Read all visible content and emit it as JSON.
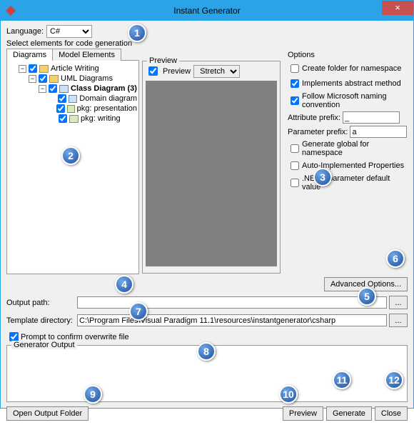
{
  "window": {
    "title": "Instant Generator"
  },
  "language": {
    "label": "Language:",
    "value": "C#"
  },
  "select_elements_label": "Select elements for code generation",
  "tabs": {
    "diagrams": "Diagrams",
    "model_elements": "Model Elements"
  },
  "tree": {
    "root": "Article Writing",
    "uml": "UML Diagrams",
    "class_diagram": "Class Diagram (3)",
    "items": [
      "Domain diagram",
      "pkg: presentation",
      "pkg: writing"
    ]
  },
  "preview": {
    "legend": "Preview",
    "checkbox_label": "Preview",
    "stretch": "Stretch"
  },
  "options": {
    "legend": "Options",
    "create_folder": "Create folder for namespace",
    "implements_abstract": "Implements abstract method",
    "follow_naming": "Follow Microsoft naming convention",
    "attr_prefix_label": "Attribute prefix:",
    "attr_prefix_value": "_",
    "param_prefix_label": "Parameter prefix:",
    "param_prefix_value": "a",
    "gen_global": "Generate global for namespace",
    "auto_impl": "Auto-Implemented Properties",
    "net4": ".NET 4 parameter default value",
    "advanced": "Advanced Options..."
  },
  "output_path": {
    "label": "Output path:",
    "value": ""
  },
  "template_dir": {
    "label": "Template directory:",
    "value": "C:\\Program Files\\Visual Paradigm 11.1\\resources\\instantgenerator\\csharp"
  },
  "prompt_overwrite": "Prompt to confirm overwrite file",
  "generator_output": "Generator Output",
  "buttons": {
    "open_output": "Open Output Folder",
    "preview": "Preview",
    "generate": "Generate",
    "close": "Close",
    "dots": "..."
  },
  "callouts": [
    "1",
    "2",
    "3",
    "4",
    "5",
    "6",
    "7",
    "8",
    "9",
    "10",
    "11",
    "12"
  ]
}
